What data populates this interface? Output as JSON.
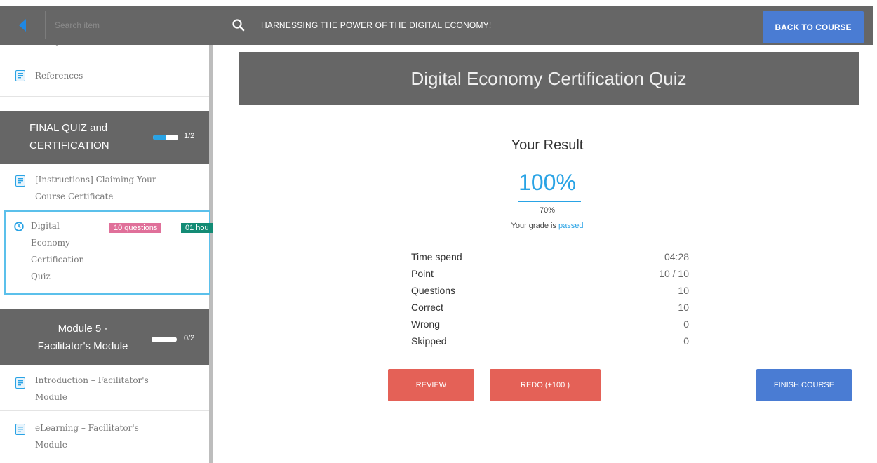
{
  "topbar": {
    "search_placeholder": "Search item",
    "course_title": "HARNESSING THE POWER OF THE DIGITAL ECONOMY!",
    "back_button": "BACK TO COURSE"
  },
  "sidebar": {
    "clipped_item": "Examples and Links",
    "items_top": [
      {
        "label": "References"
      }
    ],
    "section_final": {
      "title_line1": "FINAL QUIZ and",
      "title_line2": "CERTIFICATION",
      "progress": 0.5,
      "count": "1/2"
    },
    "item_instructions": {
      "line1": "[Instructions] Claiming Your",
      "line2": "Course Certificate"
    },
    "active_item": {
      "line1": "Digital",
      "line2": "Economy",
      "line3": "Certification",
      "line4": "Quiz",
      "badge_questions": "10 questions",
      "badge_time": "01 hou"
    },
    "section_module5": {
      "title_line1": "Module 5 -",
      "title_line2": "Facilitator's Module",
      "progress": 0.0,
      "count": "0/2"
    },
    "module5_items": [
      {
        "line1": "Introduction – Facilitator's",
        "line2": "Module"
      },
      {
        "line1": "eLearning – Facilitator's",
        "line2": "Module"
      }
    ]
  },
  "quiz": {
    "header": "Digital Economy Certification Quiz",
    "result_heading": "Your Result",
    "result_percent": "100%",
    "passing_grade": "70%",
    "grade_prefix": "Your grade is ",
    "grade_status": "passed",
    "stats": [
      {
        "label": "Time spend",
        "value": "04:28"
      },
      {
        "label": "Point",
        "value": "10 / 10"
      },
      {
        "label": "Questions",
        "value": "10"
      },
      {
        "label": "Correct",
        "value": "10"
      },
      {
        "label": "Wrong",
        "value": "0"
      },
      {
        "label": "Skipped",
        "value": "0"
      }
    ],
    "buttons": {
      "review": "REVIEW",
      "redo": "REDO (+100 )",
      "finish": "FINISH COURSE"
    }
  },
  "colors": {
    "topbar": "#666666",
    "accent_blue": "#29a3e5",
    "button_blue": "#4a7cd3",
    "button_red": "#e46157",
    "badge_pink": "#e0709a",
    "badge_green": "#138b75"
  }
}
